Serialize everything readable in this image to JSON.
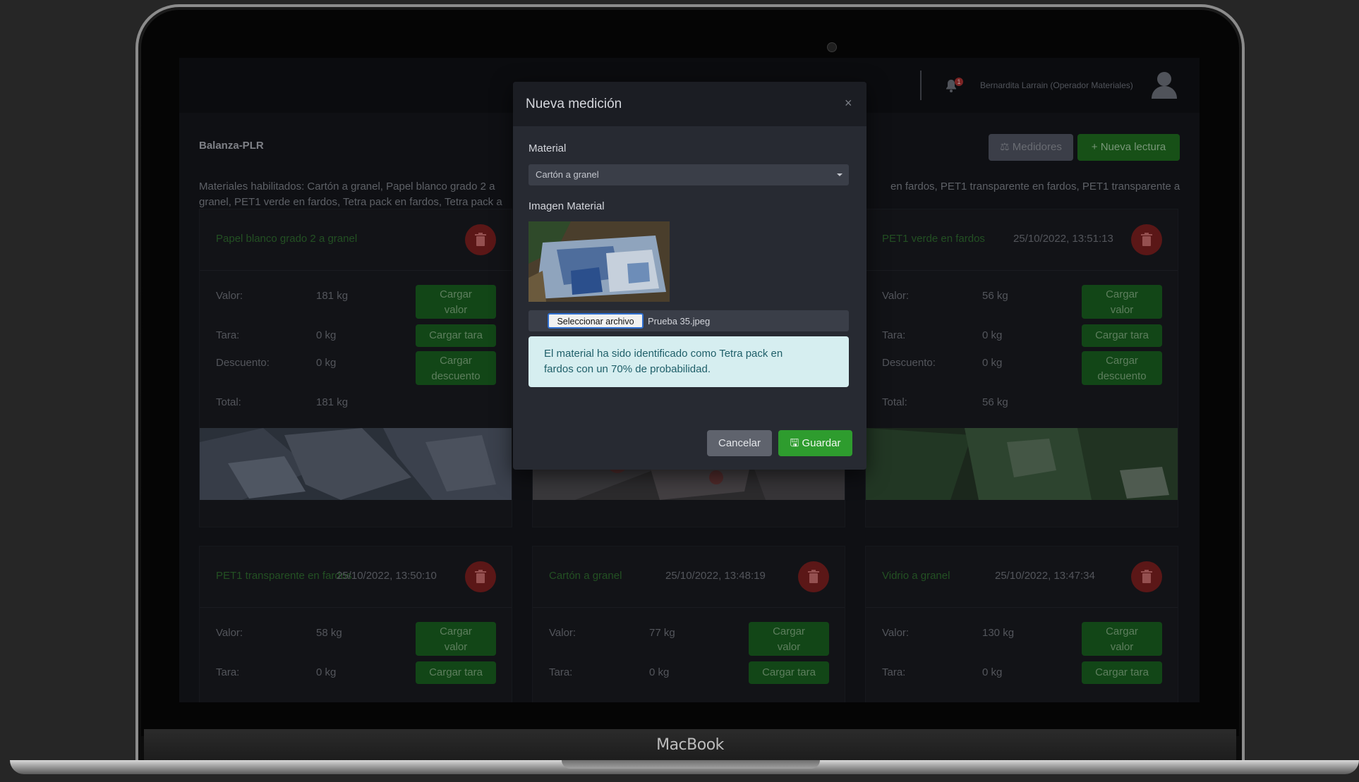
{
  "device": {
    "brand": "MacBook"
  },
  "header": {
    "notification_count": "1",
    "user": "Bernardita Larrain (Operador Materiales)"
  },
  "page": {
    "title": "Balanza-PLR",
    "buttons": {
      "medidores": "Medidores",
      "nueva_lectura": "Nueva lectura"
    },
    "materials_left": "Materiales habilitados: Cartón a granel, Papel blanco grado 2 a",
    "materials_left_2": "granel, PET1 verde en fardos, Tetra pack en fardos, Tetra pack a",
    "materials_right": "en fardos, PET1 transparente en fardos, PET1 transparente a"
  },
  "card_labels": {
    "valor": "Valor:",
    "tara": "Tara:",
    "descuento": "Descuento:",
    "total": "Total:",
    "cargar_valor": [
      "Cargar",
      "valor"
    ],
    "cargar_tara": "Cargar tara",
    "cargar_descuento": [
      "Cargar",
      "descuento"
    ]
  },
  "cards": [
    {
      "material": "Papel blanco grado 2 a granel",
      "date": "",
      "valor": "181 kg",
      "tara": "0 kg",
      "descuento": "0 kg",
      "total": "181 kg"
    },
    {
      "material": "",
      "date": "",
      "valor": "",
      "tara": "",
      "descuento": "",
      "total": ""
    },
    {
      "material": "PET1 verde en fardos",
      "date": "25/10/2022, 13:51:13",
      "valor": "56 kg",
      "tara": "0 kg",
      "descuento": "0 kg",
      "total": "56 kg"
    },
    {
      "material": "PET1 transparente en fardos",
      "date": "25/10/2022, 13:50:10",
      "valor": "58 kg",
      "tara": "0 kg"
    },
    {
      "material": "Cartón a granel",
      "date": "25/10/2022, 13:48:19",
      "valor": "77 kg",
      "tara": "0 kg"
    },
    {
      "material": "Vidrio a granel",
      "date": "25/10/2022, 13:47:34",
      "valor": "130 kg",
      "tara": "0 kg"
    }
  ],
  "modal": {
    "title": "Nueva medición",
    "close_icon": "close-icon",
    "material_label": "Material",
    "material_value": "Cartón a granel",
    "image_label": "Imagen Material",
    "file_button": "Seleccionar archivo",
    "file_name": "Prueba 35.jpeg",
    "alert_line1": "El material ha sido identificado como Tetra pack en",
    "alert_line2": "fardos con un 70% de probabilidad.",
    "cancel": "Cancelar",
    "save": "Guardar"
  },
  "colors": {
    "accent_green": "#2e9c2e",
    "danger": "#7a1f1f",
    "alert_bg": "#d6eef0"
  }
}
